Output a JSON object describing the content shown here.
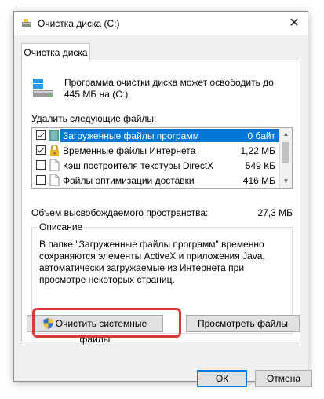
{
  "window": {
    "title": "Очистка диска  (C:)",
    "close_glyph": "✕"
  },
  "tab": {
    "label": "Очистка диска"
  },
  "summary": {
    "text": "Программа очистки диска может освободить до 445 МБ на (C:)."
  },
  "files": {
    "label": "Удалить следующие файлы:",
    "items": [
      {
        "name": "Загруженные файлы программ",
        "size": "0 байт",
        "checked": true,
        "selected": true,
        "icon": "folder-icon"
      },
      {
        "name": "Временные файлы Интернета",
        "size": "1,22 МБ",
        "checked": true,
        "selected": false,
        "icon": "lock-icon"
      },
      {
        "name": "Кэш построителя текстуры DirectX",
        "size": "549 КБ",
        "checked": false,
        "selected": false,
        "icon": "document-icon"
      },
      {
        "name": "Файлы оптимизации доставки",
        "size": "416 МБ",
        "checked": false,
        "selected": false,
        "icon": "document-icon"
      }
    ]
  },
  "freed": {
    "label": "Объем высвобождаемого пространства:",
    "value": "27,3 МБ"
  },
  "description": {
    "legend": "Описание",
    "text": "В папке \"Загруженные файлы программ\" временно сохраняются элементы ActiveX и приложения Java, автоматически загружаемые из Интернета при просмотре некоторых страниц."
  },
  "buttons": {
    "clean_system": "Очистить системные файлы",
    "view_files": "Просмотреть файлы",
    "ok": "ОК",
    "cancel": "Отмена"
  },
  "colors": {
    "selection": "#0078d7",
    "highlight": "#d83a36"
  }
}
